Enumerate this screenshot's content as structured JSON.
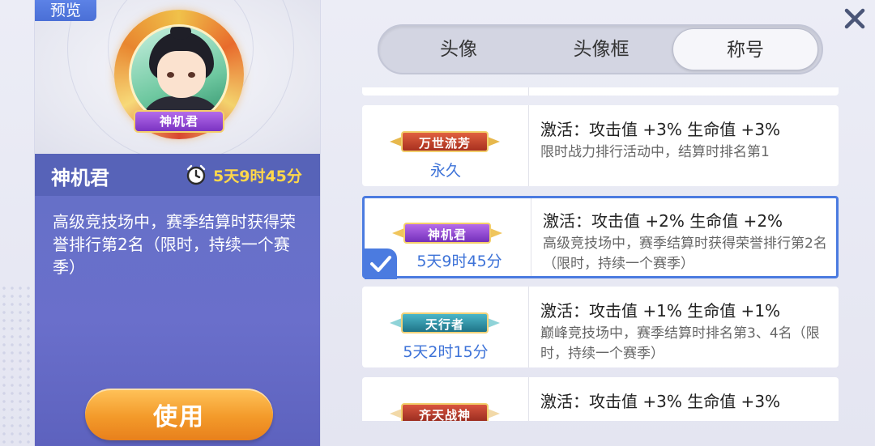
{
  "preview": {
    "tag": "预览",
    "avatar_title": "神机君",
    "name": "神机君",
    "timer": "5天9时45分",
    "description": "高级竞技场中，赛季结算时获得荣誉排行第2名（限时，持续一个赛季）",
    "use_label": "使用"
  },
  "tabs": [
    {
      "label": "头像",
      "active": false
    },
    {
      "label": "头像框",
      "active": false
    },
    {
      "label": "称号",
      "active": true
    }
  ],
  "titles": [
    {
      "badge": "万世流芳",
      "badge_color": "#c9442b",
      "duration": "永久",
      "effect": "激活：攻击值 +3% 生命值 +3%",
      "condition": "限时战力排行活动中，结算时排名第1",
      "selected": false
    },
    {
      "badge": "神机君",
      "badge_color": "#8a3fd0",
      "duration": "5天9时45分",
      "effect": "激活：攻击值 +2% 生命值 +2%",
      "condition": "高级竞技场中，赛季结算时获得荣誉排行第2名（限时，持续一个赛季）",
      "selected": true
    },
    {
      "badge": "天行者",
      "badge_color": "#2f8fa6",
      "duration": "5天2时15分",
      "effect": "激活：攻击值 +1% 生命值 +1%",
      "condition": "巅峰竞技场中，赛季结算时排名第3、4名（限时，持续一个赛季）",
      "selected": false
    },
    {
      "badge": "齐天战神",
      "badge_color": "#b9382f",
      "duration": "",
      "effect": "激活：攻击值 +3% 生命值 +3%",
      "condition": "",
      "selected": false
    }
  ],
  "colors": {
    "accent": "#4b7be0",
    "timer": "#ffd84a",
    "panel": "#5763b8",
    "duration_text": "#3e73d8"
  },
  "icons": [
    "clock-icon",
    "close-icon",
    "check-icon"
  ]
}
